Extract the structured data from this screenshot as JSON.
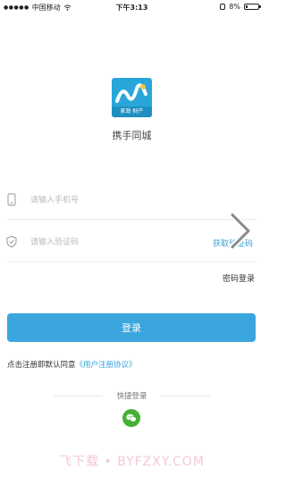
{
  "status_bar": {
    "carrier": "中国移动",
    "time": "下午3:13",
    "battery": "8%"
  },
  "app": {
    "name": "携手同城",
    "logo_text": "家政·财产"
  },
  "phone_field": {
    "placeholder": "请输入手机号",
    "value": ""
  },
  "code_field": {
    "placeholder": "请输入验证码",
    "value": ""
  },
  "get_code_label": "获取验证码",
  "password_login_label": "密码登录",
  "login_button_label": "登录",
  "agreement": {
    "prefix": "点击注册即默认同意",
    "link": "《用户注册协议》"
  },
  "quick_login_label": "快捷登录",
  "watermark": "飞下载 • BYFZXY.COM",
  "colors": {
    "accent": "#3ba5de",
    "wechat": "#45b035",
    "logo": "#29a6d9"
  }
}
